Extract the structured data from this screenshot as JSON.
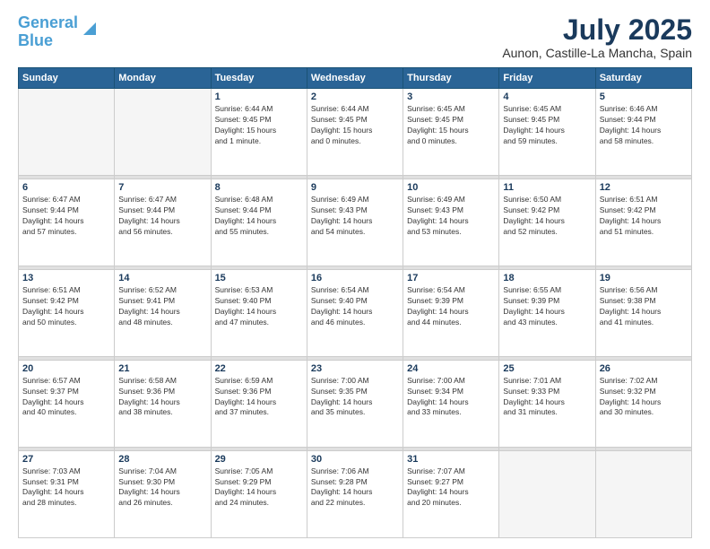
{
  "logo": {
    "line1": "General",
    "line2": "Blue"
  },
  "title": "July 2025",
  "subtitle": "Aunon, Castille-La Mancha, Spain",
  "days_of_week": [
    "Sunday",
    "Monday",
    "Tuesday",
    "Wednesday",
    "Thursday",
    "Friday",
    "Saturday"
  ],
  "weeks": [
    [
      {
        "day": "",
        "info": ""
      },
      {
        "day": "",
        "info": ""
      },
      {
        "day": "1",
        "info": "Sunrise: 6:44 AM\nSunset: 9:45 PM\nDaylight: 15 hours\nand 1 minute."
      },
      {
        "day": "2",
        "info": "Sunrise: 6:44 AM\nSunset: 9:45 PM\nDaylight: 15 hours\nand 0 minutes."
      },
      {
        "day": "3",
        "info": "Sunrise: 6:45 AM\nSunset: 9:45 PM\nDaylight: 15 hours\nand 0 minutes."
      },
      {
        "day": "4",
        "info": "Sunrise: 6:45 AM\nSunset: 9:45 PM\nDaylight: 14 hours\nand 59 minutes."
      },
      {
        "day": "5",
        "info": "Sunrise: 6:46 AM\nSunset: 9:44 PM\nDaylight: 14 hours\nand 58 minutes."
      }
    ],
    [
      {
        "day": "6",
        "info": "Sunrise: 6:47 AM\nSunset: 9:44 PM\nDaylight: 14 hours\nand 57 minutes."
      },
      {
        "day": "7",
        "info": "Sunrise: 6:47 AM\nSunset: 9:44 PM\nDaylight: 14 hours\nand 56 minutes."
      },
      {
        "day": "8",
        "info": "Sunrise: 6:48 AM\nSunset: 9:44 PM\nDaylight: 14 hours\nand 55 minutes."
      },
      {
        "day": "9",
        "info": "Sunrise: 6:49 AM\nSunset: 9:43 PM\nDaylight: 14 hours\nand 54 minutes."
      },
      {
        "day": "10",
        "info": "Sunrise: 6:49 AM\nSunset: 9:43 PM\nDaylight: 14 hours\nand 53 minutes."
      },
      {
        "day": "11",
        "info": "Sunrise: 6:50 AM\nSunset: 9:42 PM\nDaylight: 14 hours\nand 52 minutes."
      },
      {
        "day": "12",
        "info": "Sunrise: 6:51 AM\nSunset: 9:42 PM\nDaylight: 14 hours\nand 51 minutes."
      }
    ],
    [
      {
        "day": "13",
        "info": "Sunrise: 6:51 AM\nSunset: 9:42 PM\nDaylight: 14 hours\nand 50 minutes."
      },
      {
        "day": "14",
        "info": "Sunrise: 6:52 AM\nSunset: 9:41 PM\nDaylight: 14 hours\nand 48 minutes."
      },
      {
        "day": "15",
        "info": "Sunrise: 6:53 AM\nSunset: 9:40 PM\nDaylight: 14 hours\nand 47 minutes."
      },
      {
        "day": "16",
        "info": "Sunrise: 6:54 AM\nSunset: 9:40 PM\nDaylight: 14 hours\nand 46 minutes."
      },
      {
        "day": "17",
        "info": "Sunrise: 6:54 AM\nSunset: 9:39 PM\nDaylight: 14 hours\nand 44 minutes."
      },
      {
        "day": "18",
        "info": "Sunrise: 6:55 AM\nSunset: 9:39 PM\nDaylight: 14 hours\nand 43 minutes."
      },
      {
        "day": "19",
        "info": "Sunrise: 6:56 AM\nSunset: 9:38 PM\nDaylight: 14 hours\nand 41 minutes."
      }
    ],
    [
      {
        "day": "20",
        "info": "Sunrise: 6:57 AM\nSunset: 9:37 PM\nDaylight: 14 hours\nand 40 minutes."
      },
      {
        "day": "21",
        "info": "Sunrise: 6:58 AM\nSunset: 9:36 PM\nDaylight: 14 hours\nand 38 minutes."
      },
      {
        "day": "22",
        "info": "Sunrise: 6:59 AM\nSunset: 9:36 PM\nDaylight: 14 hours\nand 37 minutes."
      },
      {
        "day": "23",
        "info": "Sunrise: 7:00 AM\nSunset: 9:35 PM\nDaylight: 14 hours\nand 35 minutes."
      },
      {
        "day": "24",
        "info": "Sunrise: 7:00 AM\nSunset: 9:34 PM\nDaylight: 14 hours\nand 33 minutes."
      },
      {
        "day": "25",
        "info": "Sunrise: 7:01 AM\nSunset: 9:33 PM\nDaylight: 14 hours\nand 31 minutes."
      },
      {
        "day": "26",
        "info": "Sunrise: 7:02 AM\nSunset: 9:32 PM\nDaylight: 14 hours\nand 30 minutes."
      }
    ],
    [
      {
        "day": "27",
        "info": "Sunrise: 7:03 AM\nSunset: 9:31 PM\nDaylight: 14 hours\nand 28 minutes."
      },
      {
        "day": "28",
        "info": "Sunrise: 7:04 AM\nSunset: 9:30 PM\nDaylight: 14 hours\nand 26 minutes."
      },
      {
        "day": "29",
        "info": "Sunrise: 7:05 AM\nSunset: 9:29 PM\nDaylight: 14 hours\nand 24 minutes."
      },
      {
        "day": "30",
        "info": "Sunrise: 7:06 AM\nSunset: 9:28 PM\nDaylight: 14 hours\nand 22 minutes."
      },
      {
        "day": "31",
        "info": "Sunrise: 7:07 AM\nSunset: 9:27 PM\nDaylight: 14 hours\nand 20 minutes."
      },
      {
        "day": "",
        "info": ""
      },
      {
        "day": "",
        "info": ""
      }
    ]
  ]
}
